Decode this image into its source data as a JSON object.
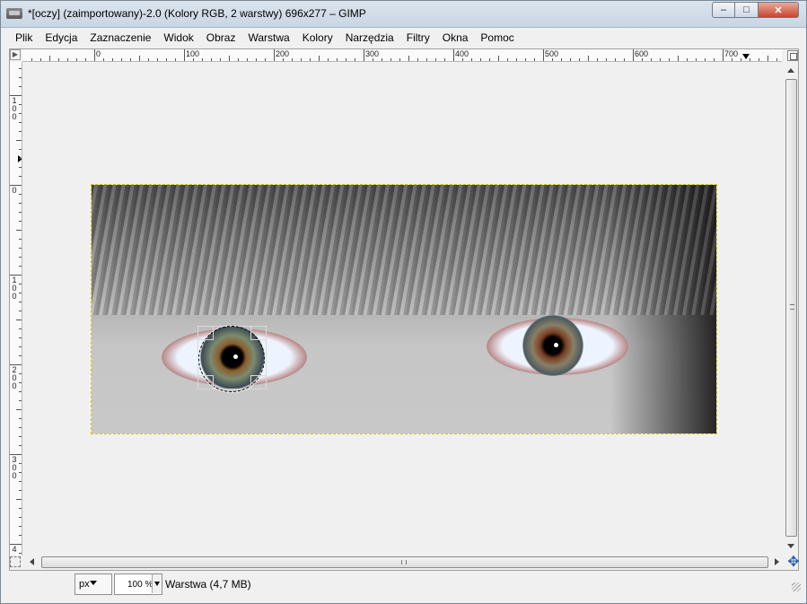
{
  "window": {
    "title": "*[oczy] (zaimportowany)-2.0 (Kolory RGB, 2 warstwy) 696x277 – GIMP",
    "minimize_icon": "minimize-icon",
    "maximize_icon": "maximize-icon",
    "close_icon": "close-icon"
  },
  "menubar": {
    "items": [
      "Plik",
      "Edycja",
      "Zaznaczenie",
      "Widok",
      "Obraz",
      "Warstwa",
      "Kolory",
      "Narzędzia",
      "Filtry",
      "Okna",
      "Pomoc"
    ]
  },
  "rulers": {
    "horizontal_labels": [
      "0",
      "100",
      "200",
      "300",
      "400",
      "500",
      "600",
      "700"
    ],
    "vertical_labels": [
      "1\n0\n0",
      "0",
      "1\n0\n0",
      "2\n0\n0",
      "3\n0\n0",
      "4"
    ]
  },
  "image": {
    "width": 696,
    "height": 277,
    "description_tool": "ellipse-select"
  },
  "statusbar": {
    "unit": "px",
    "zoom": "100 %",
    "layer_info": "Warstwa (4,7 MB)"
  },
  "icons": {
    "app": "gimp-icon",
    "quick_mask": "quick-mask-icon",
    "navigate": "navigate-icon",
    "menu_button": "image-menu-icon"
  }
}
